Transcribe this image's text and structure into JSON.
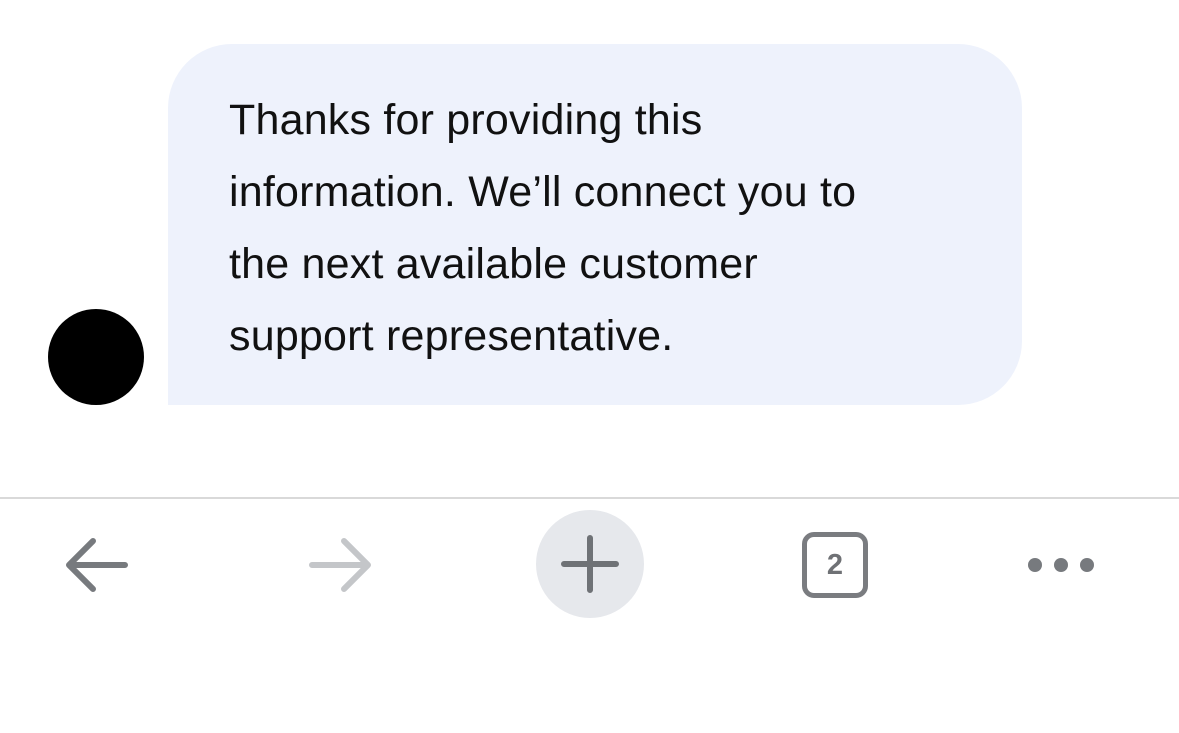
{
  "chat": {
    "message": {
      "lines": [
        "Thanks for providing this",
        "information. We’ll connect you to",
        "the next available customer",
        "support representative."
      ]
    },
    "avatar_color": "#000000",
    "bubble_color": "#eef2fc"
  },
  "toolbar": {
    "back_icon": "arrow-left-icon",
    "forward_icon": "arrow-right-icon",
    "new_tab_icon": "plus-icon",
    "tab_count": "2",
    "more_icon": "ellipsis-icon",
    "forward_enabled": false
  }
}
